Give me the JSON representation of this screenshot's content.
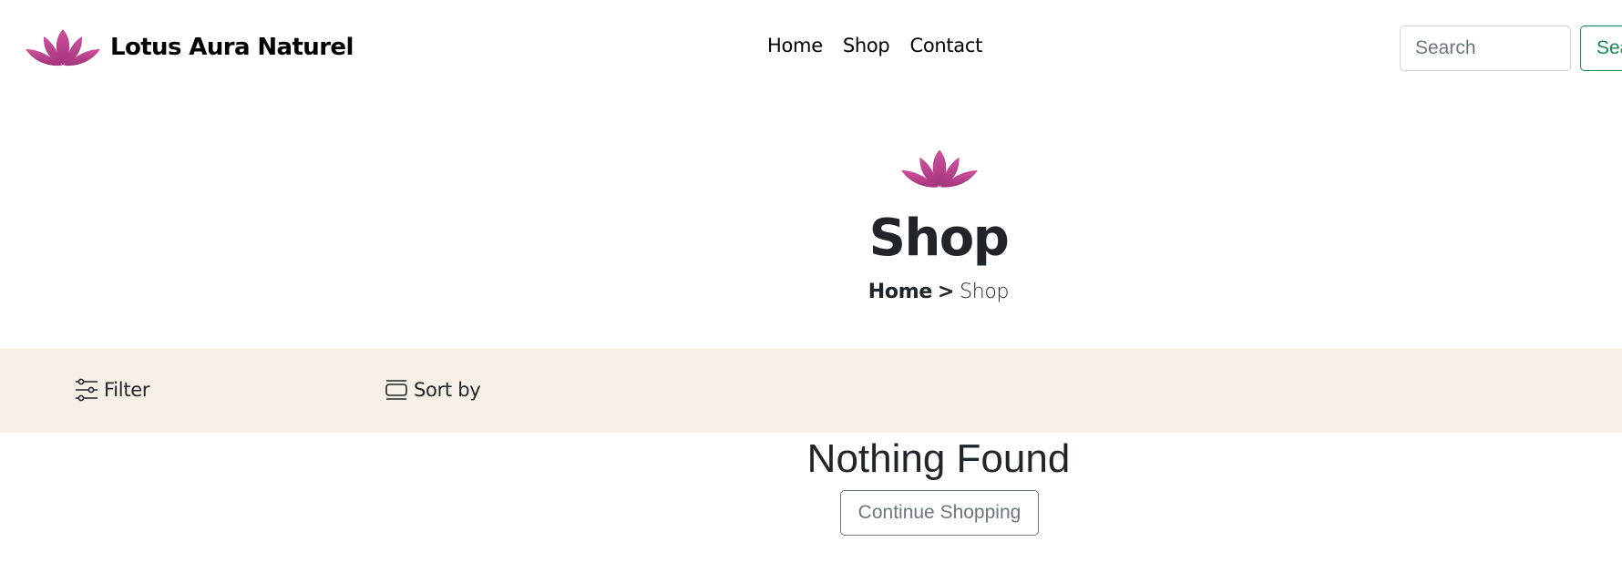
{
  "header": {
    "brand_name": "Lotus Aura Naturel",
    "logo_icon": "lotus-icon",
    "nav": [
      {
        "label": "Home"
      },
      {
        "label": "Shop"
      },
      {
        "label": "Contact"
      }
    ],
    "search": {
      "placeholder": "Search",
      "value": "",
      "button_label": "Search"
    }
  },
  "hero": {
    "icon": "lotus-icon",
    "title": "Shop",
    "breadcrumb": {
      "home": "Home",
      "separator": ">",
      "current": "Shop"
    }
  },
  "toolbar": {
    "filter_label": "Filter",
    "filter_icon": "sliders-icon",
    "sort_label": "Sort by",
    "sort_icon": "stack-icon",
    "background": "#f6f0e6"
  },
  "empty_state": {
    "title": "Nothing Found",
    "button_label": "Continue Shopping"
  },
  "colors": {
    "lotus_gradient_top": "#c24596",
    "lotus_gradient_bottom": "#9a2f6f",
    "search_button": "#198754",
    "outline_button": "#6c757d",
    "text": "#212529"
  }
}
